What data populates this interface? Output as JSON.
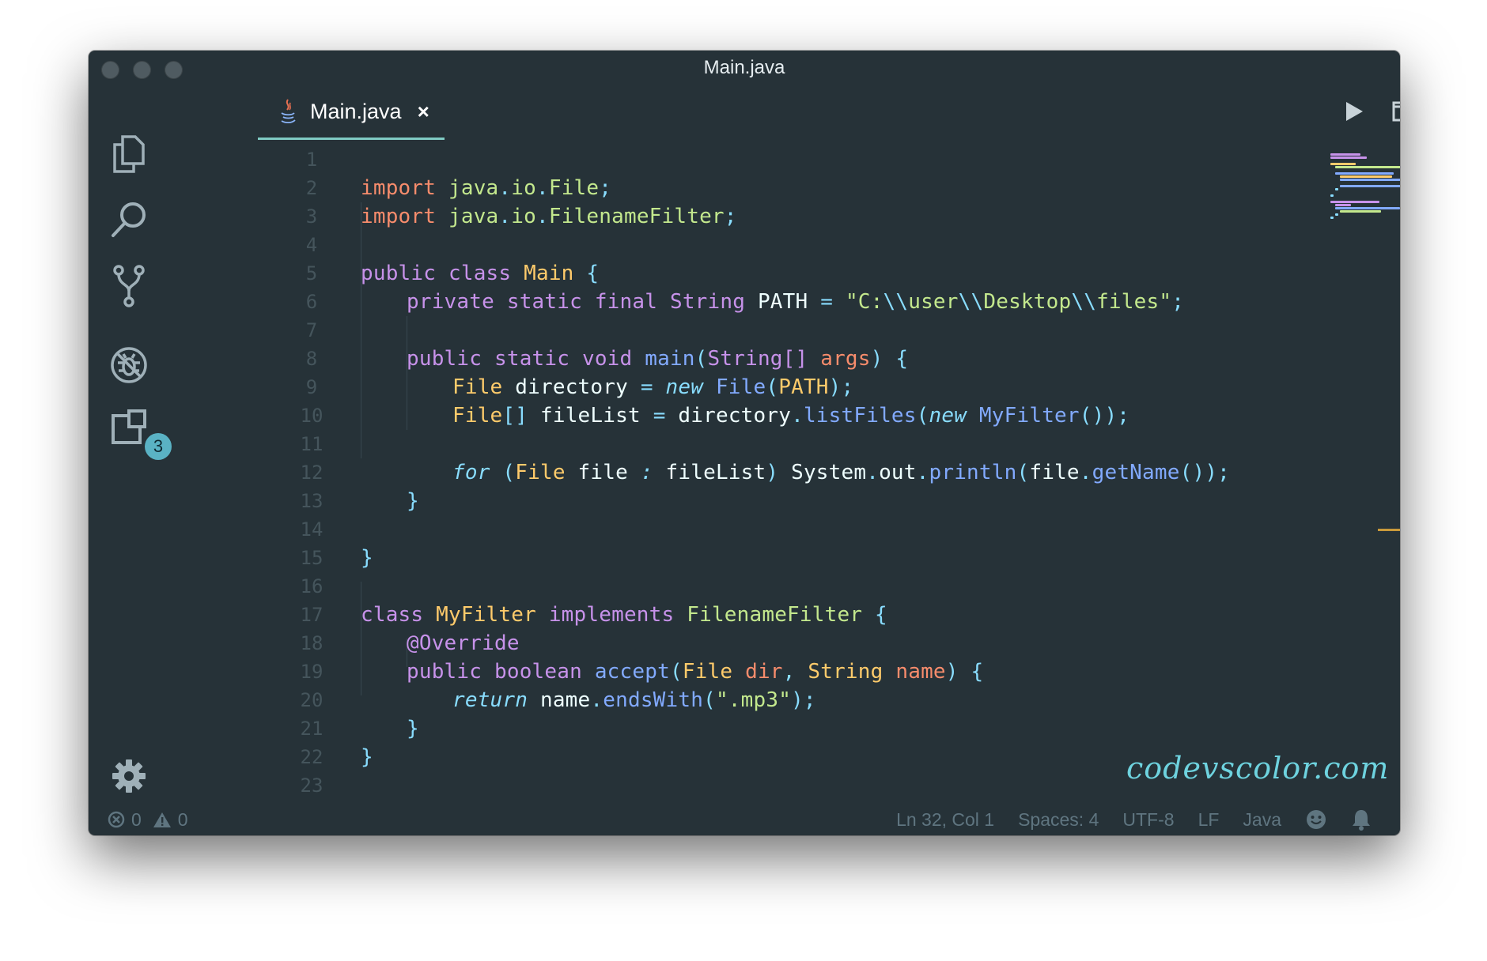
{
  "window": {
    "title": "Main.java"
  },
  "activity_bar": {
    "extensions_badge": "3"
  },
  "tab": {
    "label": "Main.java",
    "close_glyph": "×"
  },
  "editor": {
    "lines": [
      {
        "n": "1",
        "indent": 0,
        "tokens": []
      },
      {
        "n": "2",
        "indent": 0,
        "tokens": [
          [
            "imp",
            "import"
          ],
          [
            "wt",
            " "
          ],
          [
            "gr",
            "java"
          ],
          [
            "pu",
            "."
          ],
          [
            "gr",
            "io"
          ],
          [
            "pu",
            "."
          ],
          [
            "gr",
            "File"
          ],
          [
            "pu",
            ";"
          ]
        ]
      },
      {
        "n": "3",
        "indent": 0,
        "tokens": [
          [
            "imp",
            "import"
          ],
          [
            "wt",
            " "
          ],
          [
            "gr",
            "java"
          ],
          [
            "pu",
            "."
          ],
          [
            "gr",
            "io"
          ],
          [
            "pu",
            "."
          ],
          [
            "gr",
            "FilenameFilter"
          ],
          [
            "pu",
            ";"
          ]
        ]
      },
      {
        "n": "4",
        "indent": 0,
        "tokens": []
      },
      {
        "n": "5",
        "indent": 0,
        "tokens": [
          [
            "kw",
            "public"
          ],
          [
            "wt",
            " "
          ],
          [
            "kw",
            "class"
          ],
          [
            "wt",
            " "
          ],
          [
            "ty",
            "Main"
          ],
          [
            "wt",
            " "
          ],
          [
            "pu",
            "{"
          ]
        ]
      },
      {
        "n": "6",
        "indent": 1,
        "tokens": [
          [
            "kw",
            "private"
          ],
          [
            "wt",
            " "
          ],
          [
            "kw",
            "static"
          ],
          [
            "wt",
            " "
          ],
          [
            "kw",
            "final"
          ],
          [
            "wt",
            " "
          ],
          [
            "kw",
            "String"
          ],
          [
            "wt",
            " PATH "
          ],
          [
            "pu",
            "="
          ],
          [
            "wt",
            " "
          ],
          [
            "gr",
            "\"C:"
          ],
          [
            "pu",
            "\\\\"
          ],
          [
            "gr",
            "user"
          ],
          [
            "pu",
            "\\\\"
          ],
          [
            "gr",
            "Desktop"
          ],
          [
            "pu",
            "\\\\"
          ],
          [
            "gr",
            "files\""
          ],
          [
            "pu",
            ";"
          ]
        ]
      },
      {
        "n": "7",
        "indent": 1,
        "tokens": []
      },
      {
        "n": "8",
        "indent": 1,
        "tokens": [
          [
            "kw",
            "public"
          ],
          [
            "wt",
            " "
          ],
          [
            "kw",
            "static"
          ],
          [
            "wt",
            " "
          ],
          [
            "kw",
            "void"
          ],
          [
            "wt",
            " "
          ],
          [
            "fn",
            "main"
          ],
          [
            "pu",
            "("
          ],
          [
            "kw",
            "String[]"
          ],
          [
            "wt",
            " "
          ],
          [
            "prm",
            "args"
          ],
          [
            "pu",
            ")"
          ],
          [
            "wt",
            " "
          ],
          [
            "pu",
            "{"
          ]
        ]
      },
      {
        "n": "9",
        "indent": 2,
        "tokens": [
          [
            "ty",
            "File"
          ],
          [
            "wt",
            " directory "
          ],
          [
            "pu",
            "="
          ],
          [
            "wt",
            " "
          ],
          [
            "it",
            "new"
          ],
          [
            "wt",
            " "
          ],
          [
            "fn",
            "File"
          ],
          [
            "pu",
            "("
          ],
          [
            "ty",
            "PATH"
          ],
          [
            "pu",
            ");"
          ]
        ]
      },
      {
        "n": "10",
        "indent": 2,
        "tokens": [
          [
            "ty",
            "File"
          ],
          [
            "pu",
            "[]"
          ],
          [
            "wt",
            " fileList "
          ],
          [
            "pu",
            "="
          ],
          [
            "wt",
            " directory"
          ],
          [
            "pu",
            "."
          ],
          [
            "fn",
            "listFiles"
          ],
          [
            "pu",
            "("
          ],
          [
            "it",
            "new"
          ],
          [
            "wt",
            " "
          ],
          [
            "fn",
            "MyFilter"
          ],
          [
            "pu",
            "());"
          ]
        ]
      },
      {
        "n": "11",
        "indent": 2,
        "tokens": []
      },
      {
        "n": "12",
        "indent": 2,
        "tokens": [
          [
            "it",
            "for"
          ],
          [
            "wt",
            " "
          ],
          [
            "pu",
            "("
          ],
          [
            "ty",
            "File"
          ],
          [
            "wt",
            " file "
          ],
          [
            "it",
            ":"
          ],
          [
            "wt",
            " fileList"
          ],
          [
            "pu",
            ")"
          ],
          [
            "wt",
            " System"
          ],
          [
            "pu",
            "."
          ],
          [
            "wt",
            "out"
          ],
          [
            "pu",
            "."
          ],
          [
            "fn",
            "println"
          ],
          [
            "pu",
            "("
          ],
          [
            "wt",
            "file"
          ],
          [
            "pu",
            "."
          ],
          [
            "fn",
            "getName"
          ],
          [
            "pu",
            "());"
          ]
        ]
      },
      {
        "n": "13",
        "indent": 1,
        "tokens": [
          [
            "pu",
            "}"
          ]
        ]
      },
      {
        "n": "14",
        "indent": 1,
        "tokens": []
      },
      {
        "n": "15",
        "indent": 0,
        "tokens": [
          [
            "pu",
            "}"
          ]
        ]
      },
      {
        "n": "16",
        "indent": 0,
        "tokens": []
      },
      {
        "n": "17",
        "indent": 0,
        "tokens": [
          [
            "kw",
            "class"
          ],
          [
            "wt",
            " "
          ],
          [
            "ty",
            "MyFilter"
          ],
          [
            "wt",
            " "
          ],
          [
            "kw",
            "implements"
          ],
          [
            "wt",
            " "
          ],
          [
            "gr",
            "FilenameFilter"
          ],
          [
            "wt",
            " "
          ],
          [
            "pu",
            "{"
          ]
        ]
      },
      {
        "n": "18",
        "indent": 1,
        "tokens": [
          [
            "kw",
            "@Override"
          ]
        ]
      },
      {
        "n": "19",
        "indent": 1,
        "tokens": [
          [
            "kw",
            "public"
          ],
          [
            "wt",
            " "
          ],
          [
            "kw",
            "boolean"
          ],
          [
            "wt",
            " "
          ],
          [
            "fn",
            "accept"
          ],
          [
            "pu",
            "("
          ],
          [
            "ty",
            "File"
          ],
          [
            "wt",
            " "
          ],
          [
            "prm",
            "dir"
          ],
          [
            "pu",
            ","
          ],
          [
            "wt",
            " "
          ],
          [
            "ty",
            "String"
          ],
          [
            "wt",
            " "
          ],
          [
            "prm",
            "name"
          ],
          [
            "pu",
            ")"
          ],
          [
            "wt",
            " "
          ],
          [
            "pu",
            "{"
          ]
        ]
      },
      {
        "n": "20",
        "indent": 2,
        "tokens": [
          [
            "it",
            "return"
          ],
          [
            "wt",
            " name"
          ],
          [
            "pu",
            "."
          ],
          [
            "fn",
            "endsWith"
          ],
          [
            "pu",
            "("
          ],
          [
            "gr",
            "\".mp3\""
          ],
          [
            "pu",
            ");"
          ]
        ]
      },
      {
        "n": "21",
        "indent": 1,
        "tokens": [
          [
            "pu",
            "}"
          ]
        ]
      },
      {
        "n": "22",
        "indent": 0,
        "tokens": [
          [
            "pu",
            "}"
          ]
        ]
      },
      {
        "n": "23",
        "indent": 0,
        "tokens": []
      }
    ]
  },
  "watermark": "codevscolor.com",
  "status": {
    "errors": "0",
    "warnings": "0",
    "position": "Ln 32, Col 1",
    "spaces": "Spaces: 4",
    "encoding": "UTF-8",
    "eol": "LF",
    "language": "Java"
  },
  "icons": {
    "activity": [
      "explorer-icon",
      "search-icon",
      "source-control-icon",
      "debug-icon",
      "extensions-icon",
      "settings-gear-icon"
    ],
    "toolbar": [
      "run-icon",
      "split-editor-icon",
      "more-actions-icon"
    ],
    "status": [
      "error-icon",
      "warning-icon",
      "feedback-smiley-icon",
      "notifications-bell-icon"
    ]
  },
  "colors": {
    "background": "#263238",
    "keyword": "#c792ea",
    "import": "#f78c6c",
    "type": "#ffcb6b",
    "string": "#c3e88d",
    "function": "#82aaff",
    "punctuation": "#89ddff",
    "accent": "#80cbc4",
    "badge": "#5ab2c4"
  }
}
